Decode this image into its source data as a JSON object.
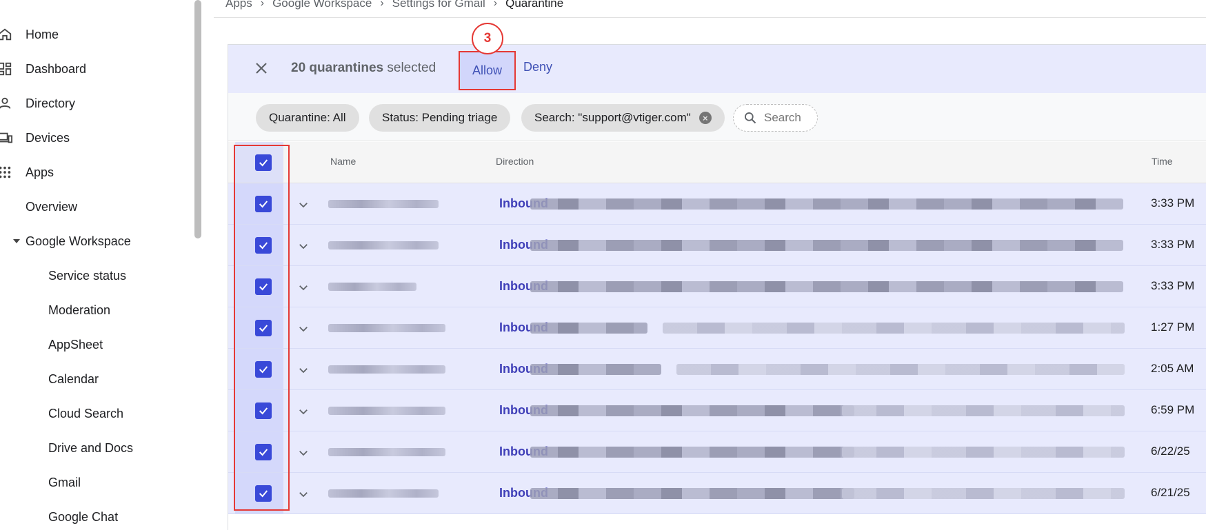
{
  "sidebar": {
    "items": [
      {
        "label": "Home",
        "icon": "home-icon"
      },
      {
        "label": "Dashboard",
        "icon": "dashboard-icon"
      },
      {
        "label": "Directory",
        "icon": "person-icon"
      },
      {
        "label": "Devices",
        "icon": "devices-icon"
      },
      {
        "label": "Apps",
        "icon": "apps-grid-icon"
      },
      {
        "label": "Overview"
      },
      {
        "label": "Google Workspace"
      },
      {
        "label": "Service status"
      },
      {
        "label": "Moderation"
      },
      {
        "label": "AppSheet"
      },
      {
        "label": "Calendar"
      },
      {
        "label": "Cloud Search"
      },
      {
        "label": "Drive and Docs"
      },
      {
        "label": "Gmail"
      },
      {
        "label": "Google Chat"
      }
    ]
  },
  "breadcrumb": [
    "Apps",
    "Google Workspace",
    "Settings for Gmail",
    "Quarantine"
  ],
  "action_bar": {
    "selection_count": "20 quarantines",
    "selection_suffix": "selected",
    "allow_label": "Allow",
    "deny_label": "Deny",
    "step_badge": "3"
  },
  "filters": {
    "chips": [
      "Quarantine: All",
      "Status: Pending triage",
      "Search: \"support@vtiger.com\""
    ],
    "search_placeholder": "Search"
  },
  "table": {
    "columns": {
      "name": "Name",
      "direction": "Direction",
      "time": "Time"
    },
    "rows": [
      {
        "direction": "Inbound",
        "time": "3:33 PM"
      },
      {
        "direction": "Inbound",
        "time": "3:33 PM"
      },
      {
        "direction": "Inbound",
        "time": "3:33 PM"
      },
      {
        "direction": "Inbound",
        "time": "1:27 PM"
      },
      {
        "direction": "Inbound",
        "time": "2:05 AM"
      },
      {
        "direction": "Inbound",
        "time": "6:59 PM"
      },
      {
        "direction": "Inbound",
        "time": "6/22/25"
      },
      {
        "direction": "Inbound",
        "time": "6/21/25"
      }
    ]
  },
  "colors": {
    "accent": "#3949d8",
    "highlight": "#e53935",
    "selected_bg": "#e8eafd"
  }
}
